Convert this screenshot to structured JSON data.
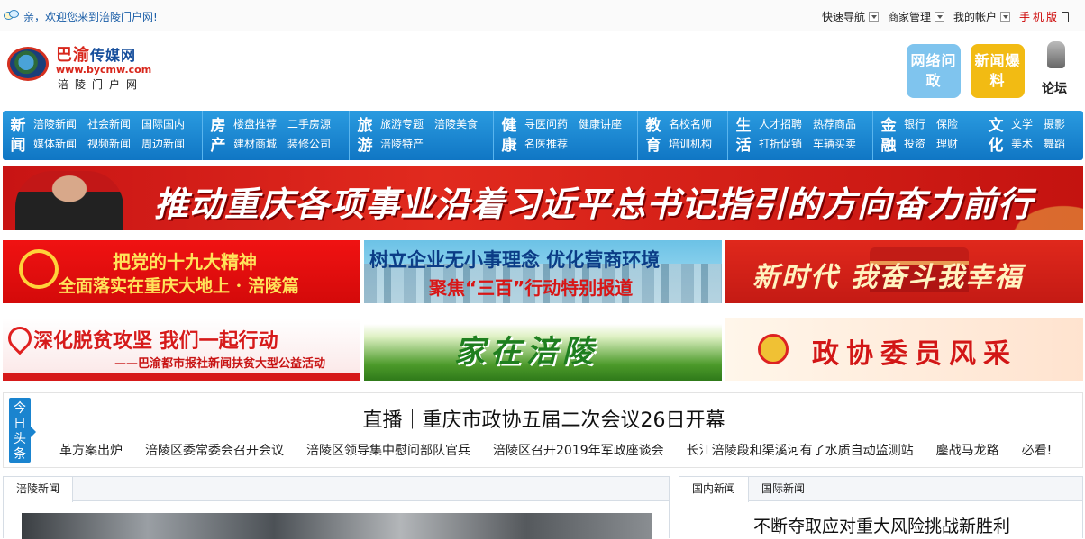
{
  "topbar": {
    "welcome": "亲，欢迎您来到涪陵门户网!",
    "nav": [
      {
        "label": "快速导航"
      },
      {
        "label": "商家管理"
      },
      {
        "label": "我的帐户"
      }
    ],
    "mobile": "手机版"
  },
  "logo": {
    "brand_a": "巴渝",
    "brand_b": "传媒网",
    "url": "www.bycmw.com",
    "sub": "涪陵门户网"
  },
  "header_buttons": {
    "net": "网络问政",
    "news": "新闻爆料",
    "forum": "论坛"
  },
  "navbar": [
    {
      "cat": "新闻",
      "links": [
        "涪陵新闻",
        "媒体新闻",
        "社会新闻",
        "视频新闻",
        "国际国内",
        "周边新闻"
      ]
    },
    {
      "cat": "房产",
      "links": [
        "楼盘推荐",
        "建材商城",
        "二手房源",
        "装修公司"
      ]
    },
    {
      "cat": "旅游",
      "links": [
        "旅游专题",
        "涪陵特产",
        "涪陵美食",
        ""
      ]
    },
    {
      "cat": "健康",
      "links": [
        "寻医问药",
        "名医推荐",
        "健康讲座",
        ""
      ]
    },
    {
      "cat": "教育",
      "links": [
        "名校名师",
        "培训机构"
      ]
    },
    {
      "cat": "生活",
      "links": [
        "人才招聘",
        "打折促销",
        "热荐商品",
        "车辆买卖"
      ]
    },
    {
      "cat": "金融",
      "links": [
        "银行",
        "投资",
        "保险",
        "理财"
      ]
    },
    {
      "cat": "文化",
      "links": [
        "文学",
        "美术",
        "摄影",
        "舞蹈"
      ]
    }
  ],
  "banners": {
    "main": "推动重庆各项事业沿着习近平总书记指引的方向奋力前行",
    "p1a": "把党的十九大精神",
    "p1b": "全面落实在重庆大地上 · 涪陵篇",
    "p2a": "树立企业无小事理念 优化营商环境",
    "p2b": "聚焦“三百”行动特别报道",
    "p3": "新时代 我奋斗我幸福",
    "p4a": "深化脱贫攻坚 我们一起行动",
    "p4b": "——巴渝都市报社新闻扶贫大型公益活动",
    "p5": "家在涪陵",
    "p6": "政协委员风采"
  },
  "headlines": {
    "tag": "今日头条",
    "title": "直播｜重庆市政协五届二次会议26日开幕",
    "items": [
      "革方案出炉",
      "涪陵区委常委会召开会议",
      "涪陵区领导集中慰问部队官兵",
      "涪陵区召开2019年军政座谈会",
      "长江涪陵段和渠溪河有了水质自动监测站",
      "鏖战马龙路",
      "必看!"
    ]
  },
  "left_panel": {
    "tabs": [
      "涪陵新闻"
    ]
  },
  "right_panel": {
    "tabs": [
      "国内新闻",
      "国际新闻"
    ],
    "story": "不断夺取应对重大风险挑战新胜利"
  }
}
